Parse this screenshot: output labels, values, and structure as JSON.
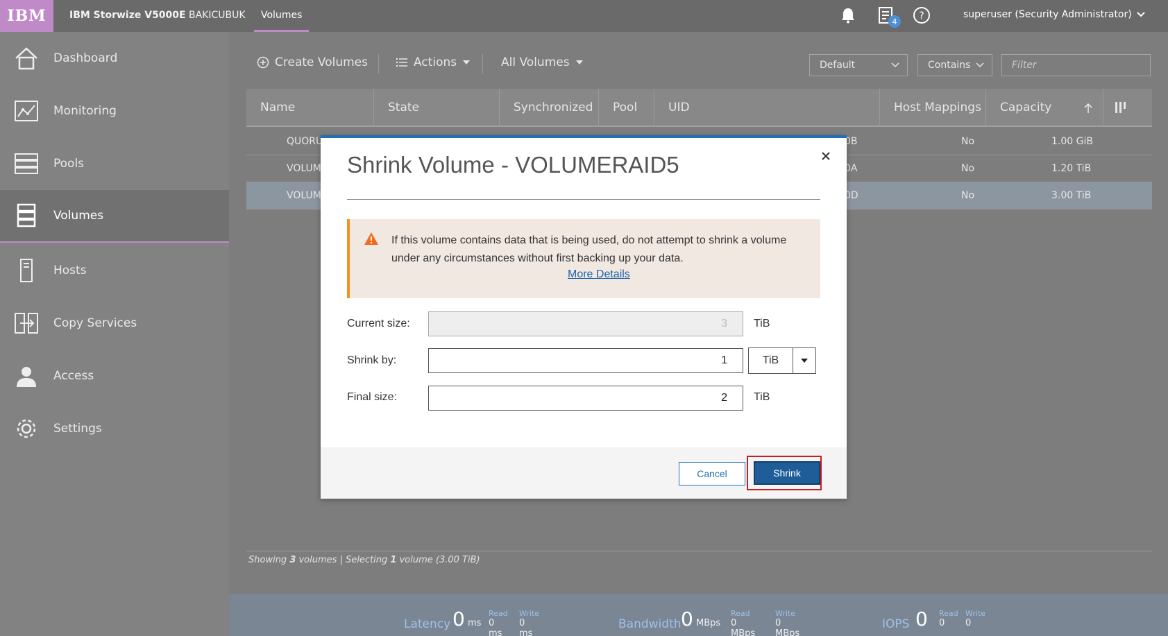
{
  "topbar": {
    "logo": "IBM",
    "product": "IBM Storwize V5000E",
    "system_name": "BAKICUBUK",
    "breadcrumb": "Volumes",
    "notification_badge": "4",
    "user": "superuser (Security Administrator)"
  },
  "sidebar": {
    "items": [
      {
        "label": "Dashboard",
        "icon": "home-icon"
      },
      {
        "label": "Monitoring",
        "icon": "monitoring-icon"
      },
      {
        "label": "Pools",
        "icon": "pools-icon"
      },
      {
        "label": "Volumes",
        "icon": "volumes-icon",
        "active": true
      },
      {
        "label": "Hosts",
        "icon": "hosts-icon"
      },
      {
        "label": "Copy Services",
        "icon": "copy-services-icon"
      },
      {
        "label": "Access",
        "icon": "access-icon"
      },
      {
        "label": "Settings",
        "icon": "settings-icon"
      }
    ]
  },
  "toolbar": {
    "create": "Create Volumes",
    "actions": "Actions",
    "view": "All Volumes",
    "filter_preset": "Default",
    "filter_mode": "Contains",
    "filter_placeholder": "Filter"
  },
  "table": {
    "columns": [
      "Name",
      "State",
      "Synchronized",
      "Pool",
      "UID",
      "Host Mappings",
      "Capacity"
    ],
    "rows": [
      {
        "name": "QUORU",
        "uid": "0B",
        "host_mappings": "No",
        "capacity": "1.00 GiB"
      },
      {
        "name": "VOLUMI",
        "uid": "0A",
        "host_mappings": "No",
        "capacity": "1.20 TiB"
      },
      {
        "name": "VOLUMI",
        "uid": "0D",
        "host_mappings": "No",
        "capacity": "3.00 TiB",
        "selected": true
      }
    ]
  },
  "status": {
    "prefix": "Showing ",
    "count": "3",
    "mid": " volumes | Selecting ",
    "selected": "1",
    "suffix": " volume (3.00 TiB)"
  },
  "footer": {
    "latency": {
      "label": "Latency",
      "value": "0",
      "unit": "ms",
      "read_label": "Read",
      "read_value": "0 ms",
      "write_label": "Write",
      "write_value": "0 ms"
    },
    "bandwidth": {
      "label": "Bandwidth",
      "value": "0",
      "unit": "MBps",
      "read_label": "Read",
      "read_value": "0 MBps",
      "write_label": "Write",
      "write_value": "0 MBps"
    },
    "iops": {
      "label": "IOPS",
      "value": "0",
      "read_label": "Read",
      "read_value": "0",
      "write_label": "Write",
      "write_value": "0"
    }
  },
  "dialog": {
    "title": "Shrink Volume - VOLUMERAID5",
    "warning": "If this volume contains data that is being used, do not attempt to shrink a volume under any circumstances without first backing up your data.",
    "more_details": "More Details",
    "current_size_label": "Current size:",
    "current_size_value": "3",
    "current_size_unit": "TiB",
    "shrink_by_label": "Shrink by:",
    "shrink_by_value": "1",
    "shrink_by_unit": "TiB",
    "final_size_label": "Final size:",
    "final_size_value": "2",
    "final_size_unit": "TiB",
    "cancel": "Cancel",
    "shrink": "Shrink"
  },
  "colors": {
    "accent": "#c08ac8",
    "primary_button": "#1f5d99",
    "dialog_border": "#1f6fb4",
    "warning": "#f29222",
    "highlight": "#c81e1e"
  }
}
